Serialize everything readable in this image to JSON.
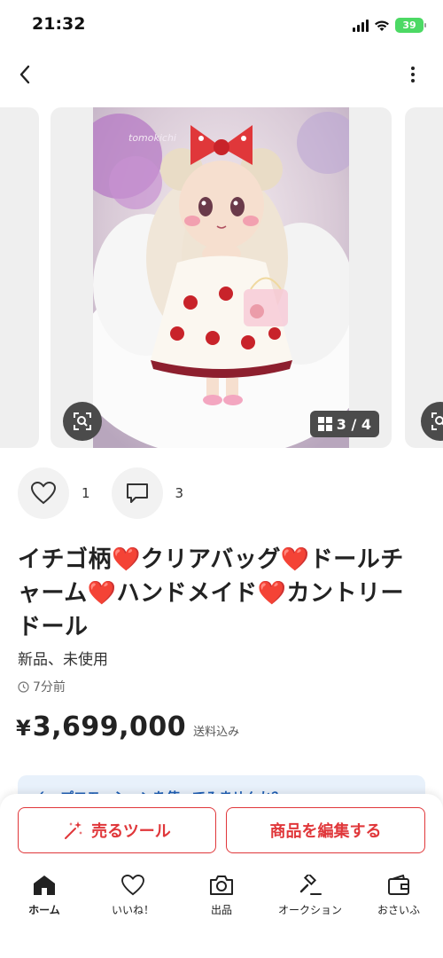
{
  "status_bar": {
    "time": "21:32",
    "battery": "39"
  },
  "gallery": {
    "counter_left": "/ 4",
    "counter_main": "3 / 4",
    "watermark": "tomokichi"
  },
  "reactions": {
    "likes": "1",
    "comments": "3"
  },
  "product": {
    "title": "イチゴ柄❤️クリアバッグ❤️ドールチャーム❤️ハンドメイド❤️カントリードール",
    "condition": "新品、未使用",
    "posted": "7分前",
    "currency": "¥",
    "price": "3,699,000",
    "shipping": "送料込み"
  },
  "promo": {
    "text": "プロモーションを使ってみませんか？"
  },
  "actions": {
    "sell_tool": "売るツール",
    "edit_item": "商品を編集する"
  },
  "colors": {
    "accent": "#e0373a",
    "badge": "#4b4b4b",
    "promo": "#1f5fb5"
  },
  "tabs": [
    {
      "label": "ホーム",
      "icon": "home-icon"
    },
    {
      "label": "いいね！",
      "icon": "heart-icon"
    },
    {
      "label": "出品",
      "icon": "camera-icon"
    },
    {
      "label": "オークション",
      "icon": "gavel-icon"
    },
    {
      "label": "おさいふ",
      "icon": "wallet-icon"
    }
  ]
}
